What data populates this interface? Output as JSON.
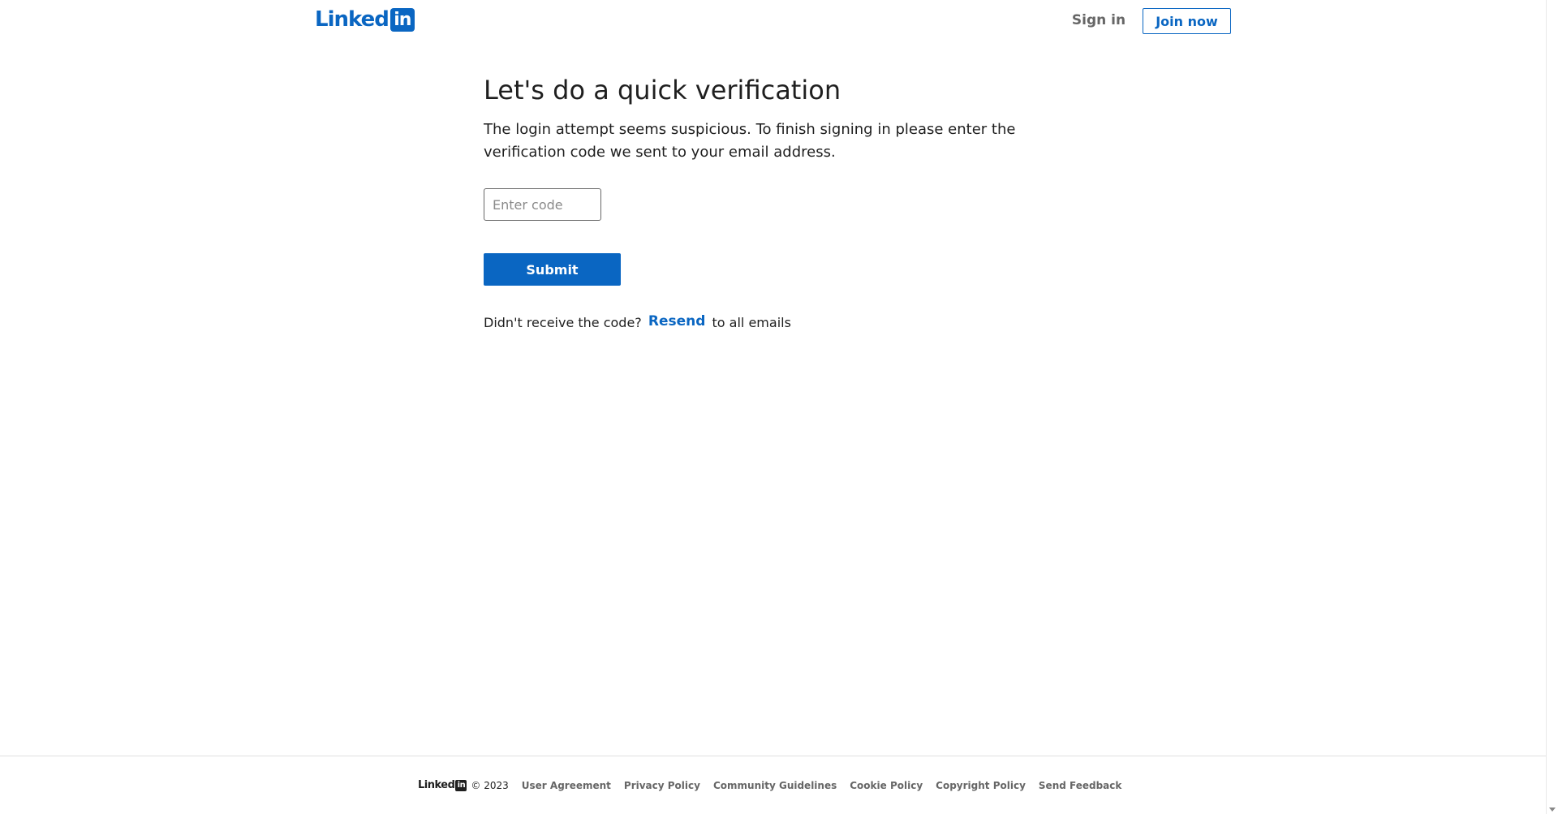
{
  "header": {
    "logo_text": "Linked",
    "logo_box": "in",
    "sign_in_label": "Sign in",
    "join_now_label": "Join now"
  },
  "main": {
    "title": "Let's do a quick verification",
    "subtitle": "The login attempt seems suspicious. To finish signing in please enter the verification code we sent to your email address.",
    "code_input": {
      "placeholder": "Enter code",
      "value": ""
    },
    "submit_label": "Submit",
    "resend_prefix": "Didn't receive the code?",
    "resend_link": "Resend",
    "resend_suffix": "to all emails"
  },
  "footer": {
    "logo_text": "Linked",
    "logo_box": "in",
    "copyright": "© 2023",
    "links": [
      "User Agreement",
      "Privacy Policy",
      "Community Guidelines",
      "Cookie Policy",
      "Copyright Policy",
      "Send Feedback"
    ]
  },
  "colors": {
    "brand": "#0a66c2",
    "text": "#1f1f1f",
    "muted": "#666666"
  }
}
